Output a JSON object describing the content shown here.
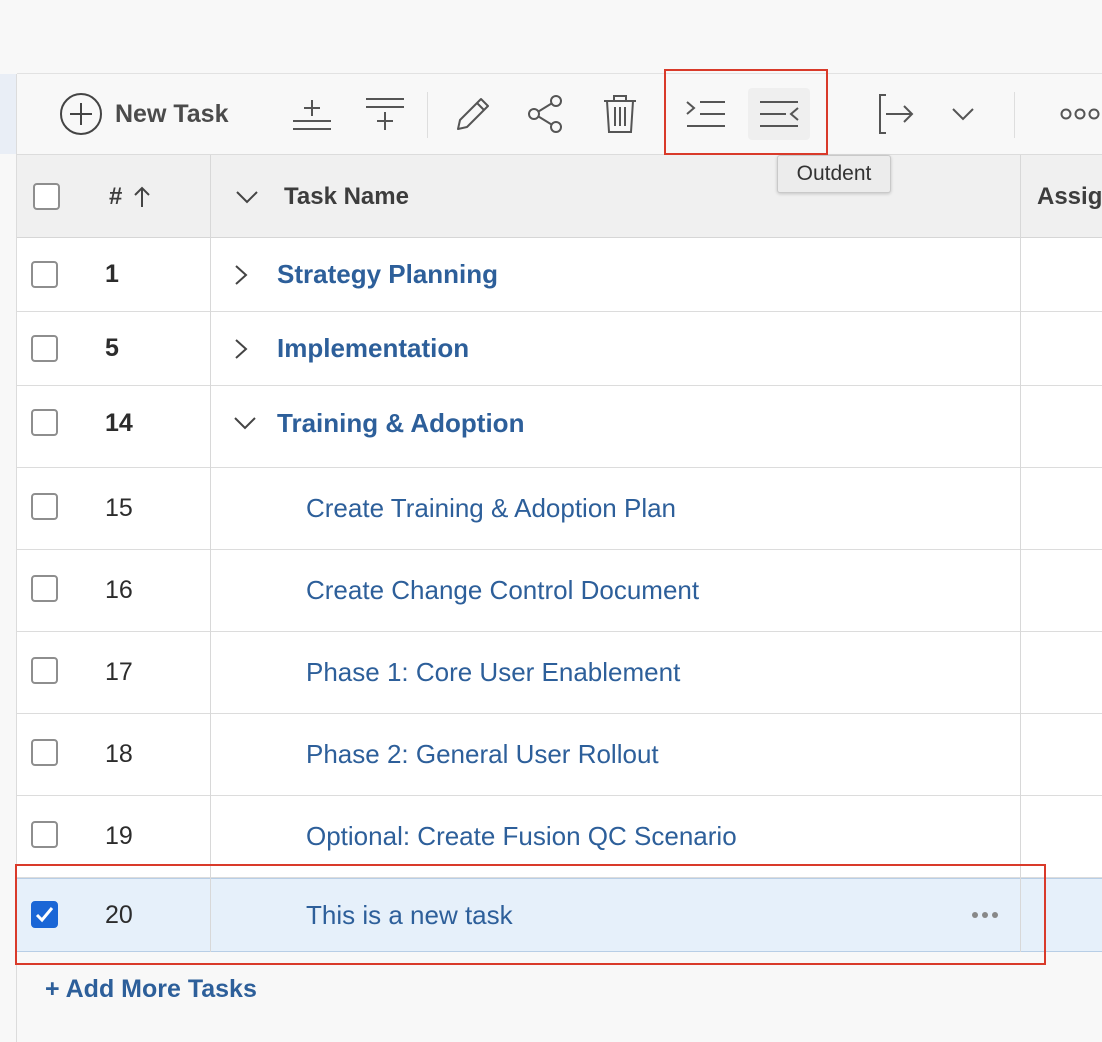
{
  "toolbar": {
    "new_task_label": "New Task",
    "icons": [
      "add-circle-icon",
      "insert-below-icon",
      "insert-above-icon",
      "pencil-icon",
      "share-icon",
      "trash-icon",
      "indent-icon",
      "outdent-icon",
      "export-icon",
      "chevron-down-icon",
      "more-horizontal-icon"
    ]
  },
  "tooltip": {
    "text": "Outdent"
  },
  "table": {
    "columns": {
      "number": "#",
      "task_name": "Task Name",
      "assignments": "Assign"
    },
    "rows": [
      {
        "num": "1",
        "name": "Strategy Planning",
        "level": "parent",
        "expanded": false,
        "checked": false
      },
      {
        "num": "5",
        "name": "Implementation",
        "level": "parent",
        "expanded": false,
        "checked": false
      },
      {
        "num": "14",
        "name": "Training & Adoption",
        "level": "parent",
        "expanded": true,
        "checked": false
      },
      {
        "num": "15",
        "name": "Create Training & Adoption Plan",
        "level": "child",
        "checked": false
      },
      {
        "num": "16",
        "name": "Create Change Control Document",
        "level": "child",
        "checked": false
      },
      {
        "num": "17",
        "name": "Phase 1: Core User Enablement",
        "level": "child",
        "checked": false
      },
      {
        "num": "18",
        "name": "Phase 2: General User Rollout",
        "level": "child",
        "checked": false
      },
      {
        "num": "19",
        "name": "Optional: Create Fusion QC Scenario",
        "level": "child",
        "checked": false
      },
      {
        "num": "20",
        "name": "This is a new task",
        "level": "child",
        "checked": true,
        "selected": true
      }
    ]
  },
  "footer": {
    "add_more_label": "+ Add More Tasks"
  },
  "colors": {
    "link": "#2d5f9a",
    "highlight_box": "#d93a2a",
    "checkbox_checked": "#1a66d6",
    "selected_row": "#e6f0fa"
  }
}
